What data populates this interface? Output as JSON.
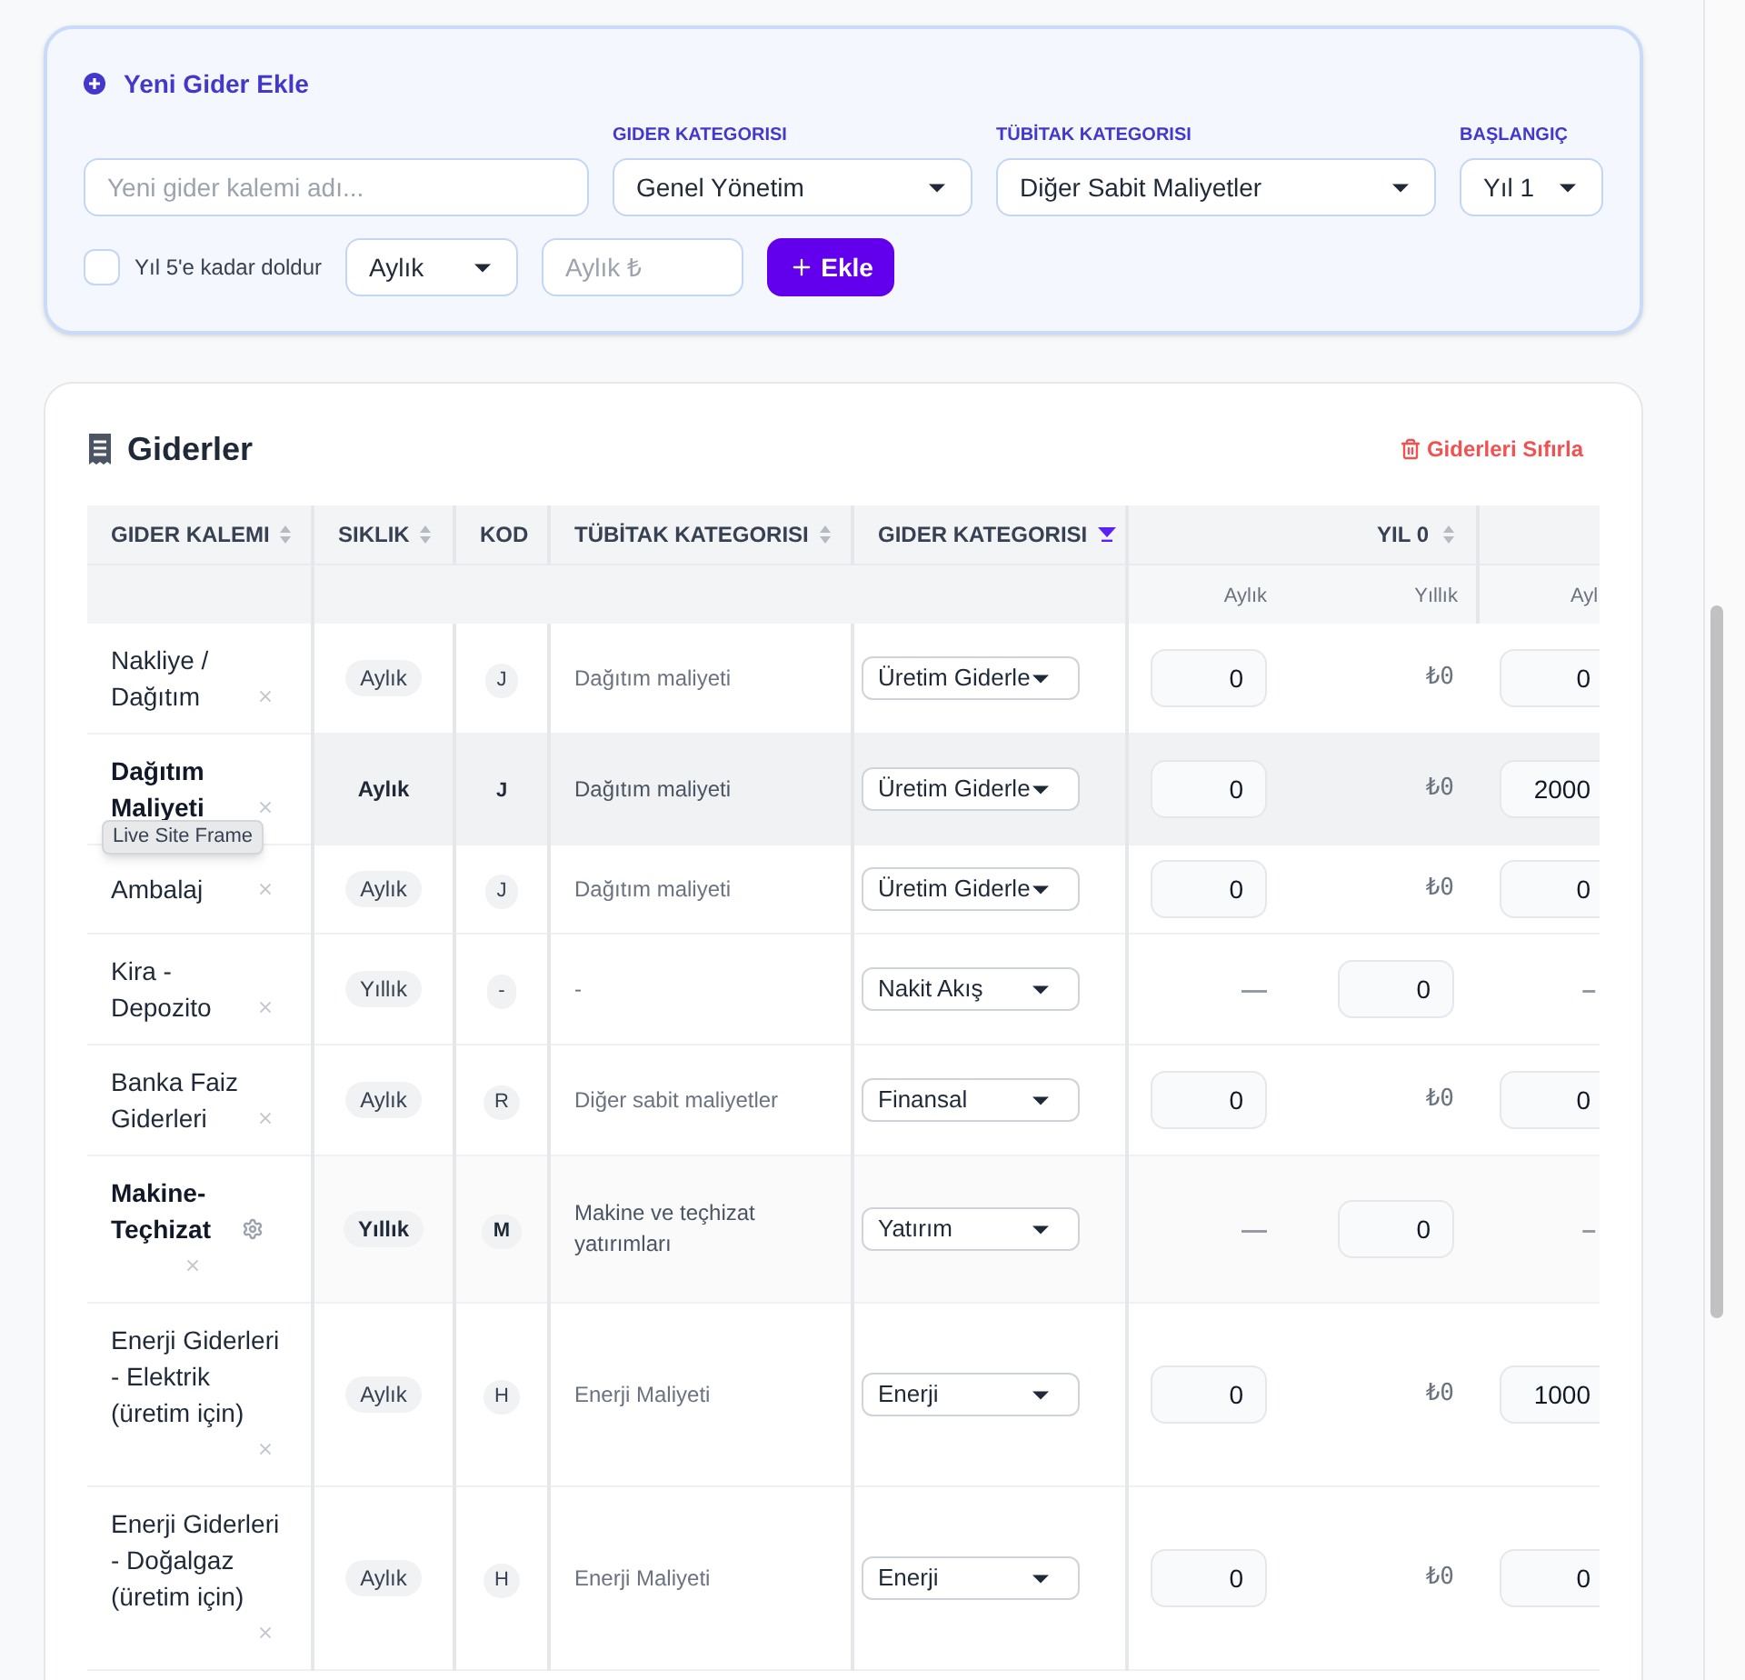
{
  "add_form": {
    "title": "Yeni Gider Ekle",
    "name_field": {
      "placeholder": "Yeni gider kalemi adı..."
    },
    "category": {
      "label": "GIDER KATEGORISI",
      "value": "Genel Yönetim"
    },
    "tubitak_category": {
      "label": "TÜBİTAK KATEGORISI",
      "value": "Diğer Sabit Maliyetler"
    },
    "start": {
      "label": "BAŞLANGIÇ",
      "value": "Yıl 1"
    },
    "fill_to_year_5": {
      "label": "Yıl 5'e kadar doldur",
      "checked": false
    },
    "frequency": {
      "value": "Aylık"
    },
    "amount_field": {
      "placeholder": "Aylık ₺"
    },
    "add_button": "Ekle"
  },
  "expenses": {
    "title": "Giderler",
    "reset_button": "Giderleri Sıfırla",
    "columns": [
      {
        "label": "GIDER KALEMI",
        "sortable": true,
        "sorted": false
      },
      {
        "label": "SIKLIK",
        "sortable": true,
        "sorted": false
      },
      {
        "label": "KOD",
        "sortable": false
      },
      {
        "label": "TÜBİTAK KATEGORISI",
        "sortable": true,
        "sorted": false
      },
      {
        "label": "GIDER KATEGORISI",
        "sortable": true,
        "sorted": true
      }
    ],
    "year_columns": [
      {
        "label": "YIL 0",
        "sortable": true,
        "sorted": false,
        "subcolumns": [
          "Aylık",
          "Yıllık"
        ]
      },
      {
        "subcolumns": [
          "Ayl"
        ]
      }
    ],
    "rows": [
      {
        "name": "Nakliye / Dağıtım",
        "highlighted": false,
        "hovered": false,
        "settings": false,
        "frequency": "Aylık",
        "code": "J",
        "tubitak": "Dağıtım maliyeti",
        "category": "Üretim Giderle",
        "year_0": [
          {
            "kind": "input",
            "value": "0"
          },
          {
            "kind": "text",
            "value": "₺0"
          }
        ],
        "year_1": {
          "kind": "input",
          "value": "0"
        }
      },
      {
        "name": "Dağıtım Maliyeti",
        "highlighted": true,
        "hovered": true,
        "settings": false,
        "tooltip": "Live Site Frame",
        "frequency": "Aylık",
        "code": "J",
        "tubitak": "Dağıtım maliyeti",
        "category": "Üretim Giderle",
        "year_0": [
          {
            "kind": "input",
            "value": "0"
          },
          {
            "kind": "text",
            "value": "₺0"
          }
        ],
        "year_1": {
          "kind": "input",
          "value": "2000"
        }
      },
      {
        "name": "Ambalaj",
        "highlighted": false,
        "hovered": false,
        "settings": false,
        "frequency": "Aylık",
        "code": "J",
        "tubitak": "Dağıtım maliyeti",
        "category": "Üretim Giderle",
        "year_0": [
          {
            "kind": "input",
            "value": "0"
          },
          {
            "kind": "text",
            "value": "₺0"
          }
        ],
        "year_1": {
          "kind": "input",
          "value": "0"
        }
      },
      {
        "name": "Kira - Depozito",
        "highlighted": false,
        "hovered": false,
        "settings": false,
        "frequency": "Yıllık",
        "code": "-",
        "tubitak": "-",
        "category": "Nakit Akış",
        "year_0": [
          {
            "kind": "dash",
            "value": "—"
          },
          {
            "kind": "input",
            "value": "0"
          }
        ],
        "year_1": {
          "kind": "dash",
          "value": "–"
        }
      },
      {
        "name": "Banka Faiz Giderleri",
        "highlighted": false,
        "hovered": false,
        "settings": false,
        "frequency": "Aylık",
        "code": "R",
        "tubitak": "Diğer sabit maliyetler",
        "category": "Finansal",
        "year_0": [
          {
            "kind": "input",
            "value": "0"
          },
          {
            "kind": "text",
            "value": "₺0"
          }
        ],
        "year_1": {
          "kind": "input",
          "value": "0"
        }
      },
      {
        "name": "Makine-Teçhizat",
        "highlighted": true,
        "hovered": false,
        "settings": true,
        "frequency": "Yıllık",
        "code": "M",
        "tubitak": "Makine ve teçhizat yatırımları",
        "category": "Yatırım",
        "year_0": [
          {
            "kind": "dash",
            "value": "—"
          },
          {
            "kind": "input",
            "value": "0"
          }
        ],
        "year_1": {
          "kind": "dash",
          "value": "–"
        }
      },
      {
        "name": "Enerji Giderleri - Elektrik (üretim için)",
        "highlighted": false,
        "hovered": false,
        "settings": false,
        "frequency": "Aylık",
        "code": "H",
        "tubitak": "Enerji Maliyeti",
        "category": "Enerji",
        "year_0": [
          {
            "kind": "input",
            "value": "0"
          },
          {
            "kind": "text",
            "value": "₺0"
          }
        ],
        "year_1": {
          "kind": "input",
          "value": "1000"
        }
      },
      {
        "name": "Enerji Giderleri - Doğalgaz (üretim için)",
        "highlighted": false,
        "hovered": false,
        "settings": false,
        "frequency": "Aylık",
        "code": "H",
        "tubitak": "Enerji Maliyeti",
        "category": "Enerji",
        "year_0": [
          {
            "kind": "input",
            "value": "0"
          },
          {
            "kind": "text",
            "value": "₺0"
          }
        ],
        "year_1": {
          "kind": "input",
          "value": "0"
        }
      }
    ]
  }
}
